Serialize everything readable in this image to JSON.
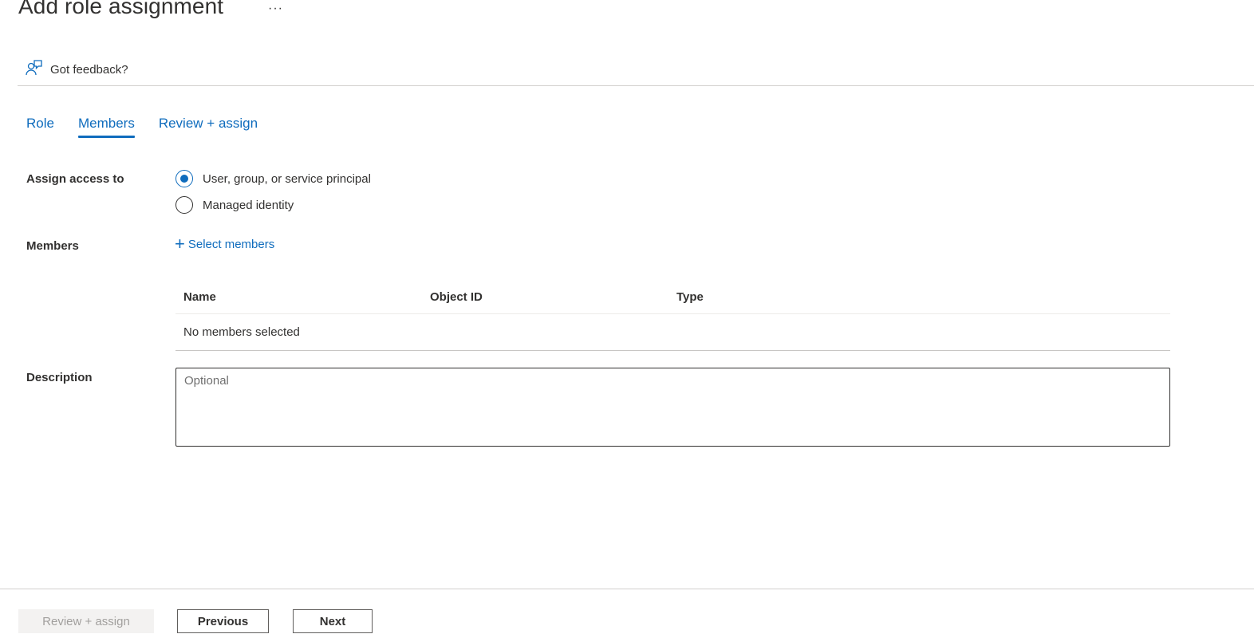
{
  "header": {
    "title": "Add role assignment",
    "more_label": "···"
  },
  "feedback": {
    "icon": "feedback-person-icon",
    "label": "Got feedback?"
  },
  "tabs": [
    {
      "label": "Role",
      "active": false
    },
    {
      "label": "Members",
      "active": true
    },
    {
      "label": "Review + assign",
      "active": false
    }
  ],
  "assign_access": {
    "label": "Assign access to",
    "options": [
      {
        "label": "User, group, or service principal",
        "checked": true
      },
      {
        "label": "Managed identity",
        "checked": false
      }
    ]
  },
  "members": {
    "label": "Members",
    "select_link": "Select members",
    "columns": [
      "Name",
      "Object ID",
      "Type"
    ],
    "empty_text": "No members selected"
  },
  "description": {
    "label": "Description",
    "placeholder": "Optional",
    "value": ""
  },
  "footer": {
    "review_assign_label": "Review + assign",
    "previous_label": "Previous",
    "next_label": "Next"
  },
  "colors": {
    "accent": "#0f6cbd",
    "text": "#323130",
    "disabled_bg": "#f3f2f1",
    "disabled_text": "#a19f9d"
  }
}
